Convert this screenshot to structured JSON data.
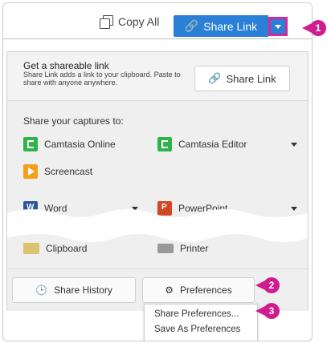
{
  "topbar": {
    "copy_all": "Copy All",
    "share_link": "Share Link"
  },
  "panel": {
    "get_link_title": "Get a shareable link",
    "get_link_desc": "Share Link adds a link to your clipboard. Paste to share with anyone anywhere.",
    "share_link_button": "Share Link",
    "share_captures_title": "Share your captures to:",
    "destinations": {
      "camtasia_online": "Camtasia Online",
      "camtasia_editor": "Camtasia Editor",
      "screencast": "Screencast",
      "word": "Word",
      "powerpoint": "PowerPoint",
      "clipboard": "Clipboard",
      "printer": "Printer"
    },
    "share_history": "Share History",
    "preferences": "Preferences"
  },
  "menu": {
    "share_preferences": "Share Preferences...",
    "save_as_preferences": "Save As Preferences"
  },
  "callouts": {
    "c1": "1",
    "c2": "2",
    "c3": "3"
  },
  "colors": {
    "accent_blue": "#2a7fd6",
    "callout_magenta": "#cf1d8f"
  }
}
